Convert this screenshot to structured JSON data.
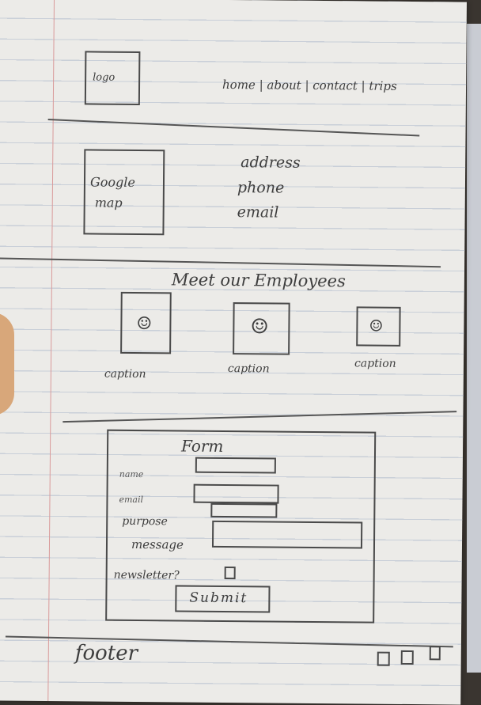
{
  "header": {
    "logo_label": "logo",
    "nav_items": [
      "home",
      "about",
      "contact",
      "trips"
    ]
  },
  "contact_section": {
    "map_label_line1": "Google",
    "map_label_line2": "map",
    "details": [
      "address",
      "phone",
      "email"
    ]
  },
  "employees_section": {
    "title": "Meet our Employees",
    "captions": [
      "caption",
      "caption",
      "caption"
    ]
  },
  "form_section": {
    "title": "Form",
    "fields": [
      "name",
      "email",
      "purpose",
      "message"
    ],
    "newsletter_label": "newsletter?",
    "submit_label": "Submit"
  },
  "footer": {
    "label": "footer"
  }
}
